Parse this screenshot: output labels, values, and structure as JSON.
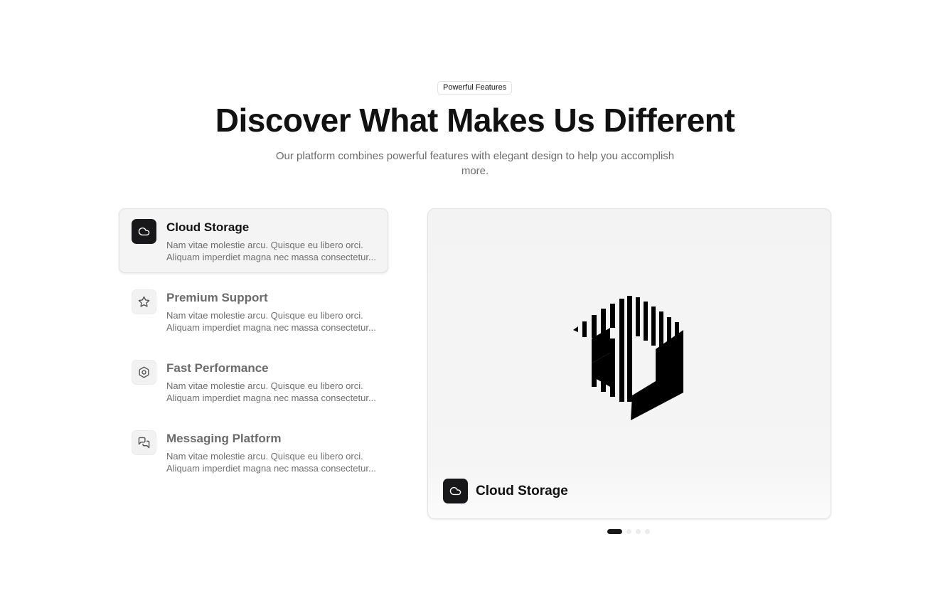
{
  "header": {
    "badge": "Powerful Features",
    "title": "Discover What Makes Us Different",
    "subtitle": "Our platform combines powerful features with elegant design to help you accomplish more."
  },
  "features": [
    {
      "title": "Cloud Storage",
      "icon": "cloud-icon",
      "active": true,
      "desc_line1": "Nam vitae molestie arcu. Quisque eu libero orci.",
      "desc_line2": "Aliquam imperdiet magna nec massa consectetur..."
    },
    {
      "title": "Premium Support",
      "icon": "star-icon",
      "active": false,
      "desc_line1": "Nam vitae molestie arcu. Quisque eu libero orci.",
      "desc_line2": "Aliquam imperdiet magna nec massa consectetur..."
    },
    {
      "title": "Fast Performance",
      "icon": "hexagon-icon",
      "active": false,
      "desc_line1": "Nam vitae molestie arcu. Quisque eu libero orci.",
      "desc_line2": "Aliquam imperdiet magna nec massa consectetur..."
    },
    {
      "title": "Messaging Platform",
      "icon": "chat-bubbles-icon",
      "active": false,
      "desc_line1": "Nam vitae molestie arcu. Quisque eu libero orci.",
      "desc_line2": "Aliquam imperdiet magna nec massa consectetur..."
    }
  ],
  "preview": {
    "icon": "cloud-icon",
    "title": "Cloud Storage",
    "image": "striped-cube-logo"
  },
  "carousel": {
    "count": 4,
    "active_index": 0
  },
  "colors": {
    "accent": "#18181b",
    "muted_text": "#6b6b6b",
    "panel_bg": "#f4f4f4"
  }
}
